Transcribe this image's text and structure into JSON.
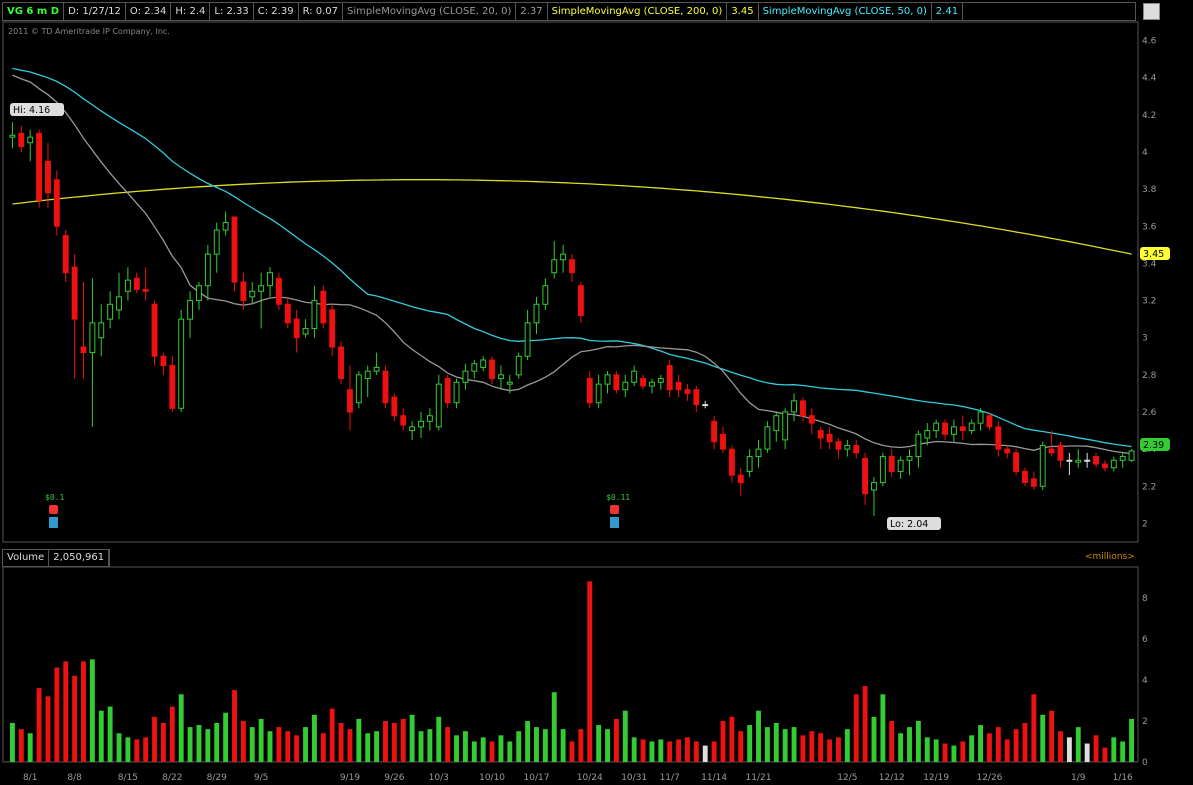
{
  "header": {
    "symbol": "VG 6 m D",
    "date": "D: 1/27/12",
    "open": "O: 2.34",
    "high": "H: 2.4",
    "low": "L: 2.33",
    "close": "C: 2.39",
    "range": "R: 0.07",
    "sma20_label": "SimpleMovingAvg (CLOSE, 20, 0)",
    "sma20_value": "2.37",
    "sma200_label": "SimpleMovingAvg (CLOSE, 200, 0)",
    "sma200_value": "3.45",
    "sma50_label": "SimpleMovingAvg (CLOSE, 50, 0)",
    "sma50_value": "2.41"
  },
  "copyright": "2011 © TD Ameritrade IP Company, Inc.",
  "volume_panel": {
    "label": "Volume",
    "value": "2,050,961",
    "units": "<millions>"
  },
  "colors": {
    "up": "#33cc33",
    "down": "#ee1111",
    "sma20": "#999999",
    "sma50": "#33ccdd",
    "sma200": "#dddd22",
    "grid": "#444444"
  },
  "chart_data": {
    "type": "candlestick",
    "price_axis": {
      "ylim": [
        1.9,
        4.7
      ],
      "ticks": [
        "4.6",
        "4.4",
        "4.2",
        "4",
        "3.8",
        "3.6",
        "3.4",
        "3.2",
        "3",
        "2.8",
        "2.6",
        "2.4",
        "2.2",
        "2"
      ]
    },
    "volume_axis": {
      "ylim": [
        0,
        9.5
      ],
      "ticks": [
        "8",
        "6",
        "4",
        "2",
        "0"
      ]
    },
    "x_tick_labels": [
      "8/1",
      "8/8",
      "8/15",
      "8/22",
      "8/29",
      "9/5",
      "9/19",
      "9/26",
      "10/3",
      "10/10",
      "10/17",
      "10/24",
      "10/31",
      "11/7",
      "11/14",
      "11/21",
      "12/5",
      "12/12",
      "12/19",
      "12/26",
      "1/9",
      "1/16"
    ],
    "badges": {
      "hi": "Hi: 4.16",
      "lo": "Lo: 2.04",
      "sma200_last": "3.45",
      "last": "2.39"
    },
    "dividends": [
      "$0.1",
      "$0.11"
    ],
    "candles": [
      {
        "o": 4.08,
        "h": 4.16,
        "l": 4.02,
        "c": 4.09,
        "v": 1.9
      },
      {
        "o": 4.1,
        "h": 4.14,
        "l": 4.0,
        "c": 4.03,
        "v": 1.6
      },
      {
        "o": 4.05,
        "h": 4.12,
        "l": 3.95,
        "c": 4.08,
        "v": 1.4
      },
      {
        "o": 4.1,
        "h": 4.12,
        "l": 3.7,
        "c": 3.74,
        "v": 3.6
      },
      {
        "o": 3.95,
        "h": 4.05,
        "l": 3.7,
        "c": 3.78,
        "v": 3.2
      },
      {
        "o": 3.85,
        "h": 3.9,
        "l": 3.55,
        "c": 3.6,
        "v": 4.6
      },
      {
        "o": 3.55,
        "h": 3.58,
        "l": 3.3,
        "c": 3.35,
        "v": 4.9
      },
      {
        "o": 3.38,
        "h": 3.45,
        "l": 2.78,
        "c": 3.1,
        "v": 4.2
      },
      {
        "o": 2.95,
        "h": 3.3,
        "l": 2.78,
        "c": 2.92,
        "v": 4.9
      },
      {
        "o": 2.92,
        "h": 3.32,
        "l": 2.52,
        "c": 3.08,
        "v": 5.0
      },
      {
        "o": 3.0,
        "h": 3.18,
        "l": 2.9,
        "c": 3.08,
        "v": 2.5
      },
      {
        "o": 3.1,
        "h": 3.25,
        "l": 3.05,
        "c": 3.18,
        "v": 2.7
      },
      {
        "o": 3.15,
        "h": 3.35,
        "l": 3.1,
        "c": 3.22,
        "v": 1.4
      },
      {
        "o": 3.25,
        "h": 3.38,
        "l": 3.2,
        "c": 3.31,
        "v": 1.2
      },
      {
        "o": 3.32,
        "h": 3.35,
        "l": 3.24,
        "c": 3.26,
        "v": 1.1
      },
      {
        "o": 3.26,
        "h": 3.38,
        "l": 3.2,
        "c": 3.25,
        "v": 1.2
      },
      {
        "o": 3.18,
        "h": 3.2,
        "l": 2.85,
        "c": 2.9,
        "v": 2.2
      },
      {
        "o": 2.9,
        "h": 2.92,
        "l": 2.8,
        "c": 2.85,
        "v": 1.9
      },
      {
        "o": 2.85,
        "h": 2.9,
        "l": 2.6,
        "c": 2.62,
        "v": 2.7
      },
      {
        "o": 2.62,
        "h": 3.15,
        "l": 2.6,
        "c": 3.1,
        "v": 3.3
      },
      {
        "o": 3.1,
        "h": 3.25,
        "l": 3.0,
        "c": 3.2,
        "v": 1.7
      },
      {
        "o": 3.2,
        "h": 3.3,
        "l": 3.15,
        "c": 3.28,
        "v": 1.8
      },
      {
        "o": 3.28,
        "h": 3.5,
        "l": 3.2,
        "c": 3.45,
        "v": 1.6
      },
      {
        "o": 3.45,
        "h": 3.62,
        "l": 3.35,
        "c": 3.58,
        "v": 1.9
      },
      {
        "o": 3.58,
        "h": 3.68,
        "l": 3.55,
        "c": 3.62,
        "v": 2.4
      },
      {
        "o": 3.65,
        "h": 3.65,
        "l": 3.25,
        "c": 3.3,
        "v": 3.5
      },
      {
        "o": 3.3,
        "h": 3.35,
        "l": 3.15,
        "c": 3.2,
        "v": 2.0
      },
      {
        "o": 3.22,
        "h": 3.3,
        "l": 3.18,
        "c": 3.25,
        "v": 1.7
      },
      {
        "o": 3.25,
        "h": 3.35,
        "l": 3.05,
        "c": 3.28,
        "v": 2.1
      },
      {
        "o": 3.28,
        "h": 3.38,
        "l": 3.22,
        "c": 3.35,
        "v": 1.5
      },
      {
        "o": 3.32,
        "h": 3.35,
        "l": 3.15,
        "c": 3.18,
        "v": 1.7
      },
      {
        "o": 3.18,
        "h": 3.22,
        "l": 3.05,
        "c": 3.08,
        "v": 1.5
      },
      {
        "o": 3.1,
        "h": 3.15,
        "l": 2.92,
        "c": 3.0,
        "v": 1.3
      },
      {
        "o": 3.02,
        "h": 3.1,
        "l": 3.0,
        "c": 3.05,
        "v": 1.7
      },
      {
        "o": 3.05,
        "h": 3.28,
        "l": 3.0,
        "c": 3.2,
        "v": 2.3
      },
      {
        "o": 3.25,
        "h": 3.28,
        "l": 3.05,
        "c": 3.08,
        "v": 1.4
      },
      {
        "o": 3.15,
        "h": 3.18,
        "l": 2.9,
        "c": 2.95,
        "v": 2.6
      },
      {
        "o": 2.95,
        "h": 2.98,
        "l": 2.75,
        "c": 2.78,
        "v": 1.9
      },
      {
        "o": 2.72,
        "h": 2.85,
        "l": 2.5,
        "c": 2.6,
        "v": 1.6
      },
      {
        "o": 2.65,
        "h": 2.82,
        "l": 2.62,
        "c": 2.8,
        "v": 2.1
      },
      {
        "o": 2.78,
        "h": 2.85,
        "l": 2.68,
        "c": 2.82,
        "v": 1.4
      },
      {
        "o": 2.82,
        "h": 2.92,
        "l": 2.8,
        "c": 2.84,
        "v": 1.5
      },
      {
        "o": 2.82,
        "h": 2.85,
        "l": 2.62,
        "c": 2.65,
        "v": 2.0
      },
      {
        "o": 2.68,
        "h": 2.7,
        "l": 2.55,
        "c": 2.58,
        "v": 1.9
      },
      {
        "o": 2.58,
        "h": 2.62,
        "l": 2.5,
        "c": 2.53,
        "v": 2.1
      },
      {
        "o": 2.5,
        "h": 2.55,
        "l": 2.45,
        "c": 2.52,
        "v": 2.3
      },
      {
        "o": 2.52,
        "h": 2.6,
        "l": 2.46,
        "c": 2.55,
        "v": 1.5
      },
      {
        "o": 2.55,
        "h": 2.62,
        "l": 2.5,
        "c": 2.58,
        "v": 1.6
      },
      {
        "o": 2.52,
        "h": 2.8,
        "l": 2.5,
        "c": 2.75,
        "v": 2.2
      },
      {
        "o": 2.78,
        "h": 2.8,
        "l": 2.62,
        "c": 2.65,
        "v": 1.7
      },
      {
        "o": 2.65,
        "h": 2.78,
        "l": 2.62,
        "c": 2.76,
        "v": 1.3
      },
      {
        "o": 2.76,
        "h": 2.86,
        "l": 2.72,
        "c": 2.82,
        "v": 1.5
      },
      {
        "o": 2.82,
        "h": 2.88,
        "l": 2.78,
        "c": 2.86,
        "v": 1.0
      },
      {
        "o": 2.84,
        "h": 2.9,
        "l": 2.82,
        "c": 2.88,
        "v": 1.2
      },
      {
        "o": 2.88,
        "h": 2.9,
        "l": 2.75,
        "c": 2.78,
        "v": 1.0
      },
      {
        "o": 2.78,
        "h": 2.85,
        "l": 2.72,
        "c": 2.8,
        "v": 1.3
      },
      {
        "o": 2.75,
        "h": 2.8,
        "l": 2.7,
        "c": 2.76,
        "v": 1.0
      },
      {
        "o": 2.8,
        "h": 2.92,
        "l": 2.78,
        "c": 2.9,
        "v": 1.5
      },
      {
        "o": 2.9,
        "h": 3.15,
        "l": 2.88,
        "c": 3.08,
        "v": 2.0
      },
      {
        "o": 3.08,
        "h": 3.22,
        "l": 3.02,
        "c": 3.18,
        "v": 1.7
      },
      {
        "o": 3.18,
        "h": 3.32,
        "l": 3.15,
        "c": 3.28,
        "v": 1.6
      },
      {
        "o": 3.35,
        "h": 3.52,
        "l": 3.32,
        "c": 3.42,
        "v": 3.4
      },
      {
        "o": 3.42,
        "h": 3.5,
        "l": 3.35,
        "c": 3.45,
        "v": 1.6
      },
      {
        "o": 3.42,
        "h": 3.45,
        "l": 3.3,
        "c": 3.35,
        "v": 1.0
      },
      {
        "o": 3.28,
        "h": 3.3,
        "l": 3.08,
        "c": 3.12,
        "v": 1.6
      },
      {
        "o": 2.78,
        "h": 2.82,
        "l": 2.62,
        "c": 2.65,
        "v": 8.8
      },
      {
        "o": 2.65,
        "h": 2.8,
        "l": 2.62,
        "c": 2.75,
        "v": 1.8
      },
      {
        "o": 2.75,
        "h": 2.82,
        "l": 2.7,
        "c": 2.8,
        "v": 1.6
      },
      {
        "o": 2.8,
        "h": 2.82,
        "l": 2.7,
        "c": 2.72,
        "v": 2.1
      },
      {
        "o": 2.72,
        "h": 2.8,
        "l": 2.68,
        "c": 2.76,
        "v": 2.5
      },
      {
        "o": 2.76,
        "h": 2.85,
        "l": 2.74,
        "c": 2.82,
        "v": 1.2
      },
      {
        "o": 2.78,
        "h": 2.8,
        "l": 2.72,
        "c": 2.74,
        "v": 1.1
      },
      {
        "o": 2.74,
        "h": 2.78,
        "l": 2.7,
        "c": 2.76,
        "v": 1.0
      },
      {
        "o": 2.76,
        "h": 2.8,
        "l": 2.72,
        "c": 2.78,
        "v": 1.1
      },
      {
        "o": 2.85,
        "h": 2.88,
        "l": 2.68,
        "c": 2.72,
        "v": 1.0
      },
      {
        "o": 2.76,
        "h": 2.8,
        "l": 2.68,
        "c": 2.72,
        "v": 1.1
      },
      {
        "o": 2.72,
        "h": 2.75,
        "l": 2.66,
        "c": 2.7,
        "v": 1.2
      },
      {
        "o": 2.72,
        "h": 2.74,
        "l": 2.6,
        "c": 2.64,
        "v": 1.0
      },
      {
        "o": 2.64,
        "h": 2.66,
        "l": 2.62,
        "c": 2.64,
        "v": 0.8
      },
      {
        "o": 2.55,
        "h": 2.58,
        "l": 2.4,
        "c": 2.44,
        "v": 1.0
      },
      {
        "o": 2.48,
        "h": 2.52,
        "l": 2.38,
        "c": 2.4,
        "v": 2.0
      },
      {
        "o": 2.4,
        "h": 2.42,
        "l": 2.22,
        "c": 2.26,
        "v": 2.2
      },
      {
        "o": 2.26,
        "h": 2.3,
        "l": 2.15,
        "c": 2.22,
        "v": 1.5
      },
      {
        "o": 2.28,
        "h": 2.4,
        "l": 2.25,
        "c": 2.36,
        "v": 1.8
      },
      {
        "o": 2.36,
        "h": 2.45,
        "l": 2.3,
        "c": 2.4,
        "v": 2.5
      },
      {
        "o": 2.4,
        "h": 2.55,
        "l": 2.38,
        "c": 2.52,
        "v": 1.7
      },
      {
        "o": 2.5,
        "h": 2.6,
        "l": 2.44,
        "c": 2.58,
        "v": 1.9
      },
      {
        "o": 2.45,
        "h": 2.62,
        "l": 2.4,
        "c": 2.6,
        "v": 1.6
      },
      {
        "o": 2.6,
        "h": 2.7,
        "l": 2.55,
        "c": 2.66,
        "v": 1.7
      },
      {
        "o": 2.66,
        "h": 2.68,
        "l": 2.55,
        "c": 2.58,
        "v": 1.3
      },
      {
        "o": 2.58,
        "h": 2.62,
        "l": 2.48,
        "c": 2.54,
        "v": 1.5
      },
      {
        "o": 2.5,
        "h": 2.52,
        "l": 2.4,
        "c": 2.46,
        "v": 1.4
      },
      {
        "o": 2.48,
        "h": 2.52,
        "l": 2.4,
        "c": 2.44,
        "v": 1.1
      },
      {
        "o": 2.44,
        "h": 2.46,
        "l": 2.35,
        "c": 2.4,
        "v": 1.2
      },
      {
        "o": 2.4,
        "h": 2.45,
        "l": 2.36,
        "c": 2.42,
        "v": 1.6
      },
      {
        "o": 2.42,
        "h": 2.45,
        "l": 2.35,
        "c": 2.38,
        "v": 3.3
      },
      {
        "o": 2.35,
        "h": 2.38,
        "l": 2.1,
        "c": 2.16,
        "v": 3.7
      },
      {
        "o": 2.18,
        "h": 2.25,
        "l": 2.04,
        "c": 2.22,
        "v": 2.2
      },
      {
        "o": 2.22,
        "h": 2.38,
        "l": 2.2,
        "c": 2.36,
        "v": 3.3
      },
      {
        "o": 2.36,
        "h": 2.4,
        "l": 2.25,
        "c": 2.28,
        "v": 2.0
      },
      {
        "o": 2.28,
        "h": 2.36,
        "l": 2.24,
        "c": 2.34,
        "v": 1.4
      },
      {
        "o": 2.34,
        "h": 2.4,
        "l": 2.26,
        "c": 2.36,
        "v": 1.7
      },
      {
        "o": 2.36,
        "h": 2.5,
        "l": 2.3,
        "c": 2.48,
        "v": 2.0
      },
      {
        "o": 2.46,
        "h": 2.54,
        "l": 2.42,
        "c": 2.5,
        "v": 1.2
      },
      {
        "o": 2.5,
        "h": 2.56,
        "l": 2.46,
        "c": 2.54,
        "v": 1.1
      },
      {
        "o": 2.54,
        "h": 2.56,
        "l": 2.45,
        "c": 2.48,
        "v": 0.9
      },
      {
        "o": 2.48,
        "h": 2.56,
        "l": 2.44,
        "c": 2.52,
        "v": 0.8
      },
      {
        "o": 2.52,
        "h": 2.58,
        "l": 2.45,
        "c": 2.5,
        "v": 1.0
      },
      {
        "o": 2.5,
        "h": 2.56,
        "l": 2.48,
        "c": 2.54,
        "v": 1.3
      },
      {
        "o": 2.54,
        "h": 2.62,
        "l": 2.5,
        "c": 2.6,
        "v": 1.8
      },
      {
        "o": 2.58,
        "h": 2.6,
        "l": 2.5,
        "c": 2.52,
        "v": 1.4
      },
      {
        "o": 2.52,
        "h": 2.55,
        "l": 2.36,
        "c": 2.4,
        "v": 1.7
      },
      {
        "o": 2.4,
        "h": 2.42,
        "l": 2.35,
        "c": 2.38,
        "v": 1.1
      },
      {
        "o": 2.38,
        "h": 2.4,
        "l": 2.26,
        "c": 2.28,
        "v": 1.6
      },
      {
        "o": 2.28,
        "h": 2.3,
        "l": 2.2,
        "c": 2.22,
        "v": 1.9
      },
      {
        "o": 2.24,
        "h": 2.28,
        "l": 2.18,
        "c": 2.2,
        "v": 3.3
      },
      {
        "o": 2.2,
        "h": 2.44,
        "l": 2.18,
        "c": 2.42,
        "v": 2.3
      },
      {
        "o": 2.4,
        "h": 2.5,
        "l": 2.36,
        "c": 2.38,
        "v": 2.5
      },
      {
        "o": 2.42,
        "h": 2.44,
        "l": 2.3,
        "c": 2.34,
        "v": 1.5
      },
      {
        "o": 2.34,
        "h": 2.38,
        "l": 2.26,
        "c": 2.34,
        "v": 1.2
      },
      {
        "o": 2.33,
        "h": 2.4,
        "l": 2.3,
        "c": 2.34,
        "v": 1.7
      },
      {
        "o": 2.34,
        "h": 2.38,
        "l": 2.3,
        "c": 2.34,
        "v": 0.9
      },
      {
        "o": 2.36,
        "h": 2.38,
        "l": 2.3,
        "c": 2.32,
        "v": 1.3
      },
      {
        "o": 2.32,
        "h": 2.34,
        "l": 2.28,
        "c": 2.3,
        "v": 0.7
      },
      {
        "o": 2.3,
        "h": 2.36,
        "l": 2.28,
        "c": 2.34,
        "v": 1.2
      },
      {
        "o": 2.34,
        "h": 2.38,
        "l": 2.3,
        "c": 2.36,
        "v": 1.0
      },
      {
        "o": 2.34,
        "h": 2.4,
        "l": 2.33,
        "c": 2.39,
        "v": 2.1
      }
    ]
  }
}
